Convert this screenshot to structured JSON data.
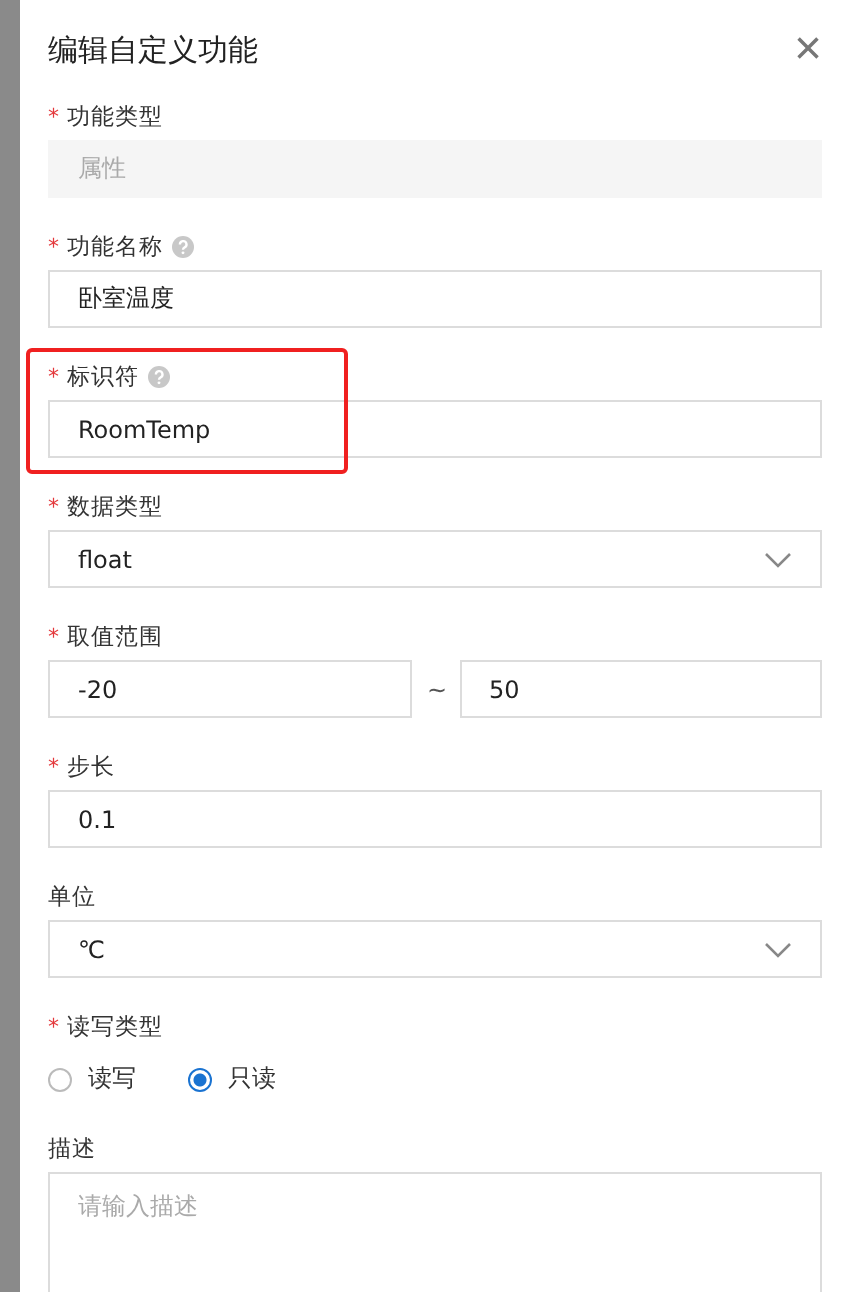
{
  "drawer": {
    "title": "编辑自定义功能",
    "close": "×"
  },
  "fields": [
    {
      "kind": "text",
      "label": "功能类型",
      "mark": "*",
      "disabled": true,
      "value": "属性"
    },
    {
      "kind": "text",
      "label": "功能名称",
      "mark": "*",
      "help": true,
      "disabled": false,
      "value": "卧室温度"
    },
    {
      "kind": "text",
      "label": "标识符",
      "mark": "*",
      "help": true,
      "disabled": false,
      "value": "RoomTemp",
      "highlighted": true
    },
    {
      "kind": "select",
      "label": "数据类型",
      "mark": "*",
      "value": "float"
    },
    {
      "kind": "range",
      "label": "取值范围",
      "mark": "*",
      "min": "-20",
      "separator": "~",
      "max": "50"
    },
    {
      "kind": "text",
      "label": "步长",
      "mark": "*",
      "disabled": false,
      "value": "0.1"
    },
    {
      "kind": "select",
      "label": "单位",
      "value": "℃"
    },
    {
      "kind": "radio",
      "label": "读写类型",
      "mark": "*",
      "options": [
        {
          "label": "读写",
          "selected": false
        },
        {
          "label": "只读",
          "selected": true
        }
      ]
    },
    {
      "kind": "textarea",
      "label": "描述",
      "placeholder": "请输入描述"
    }
  ]
}
